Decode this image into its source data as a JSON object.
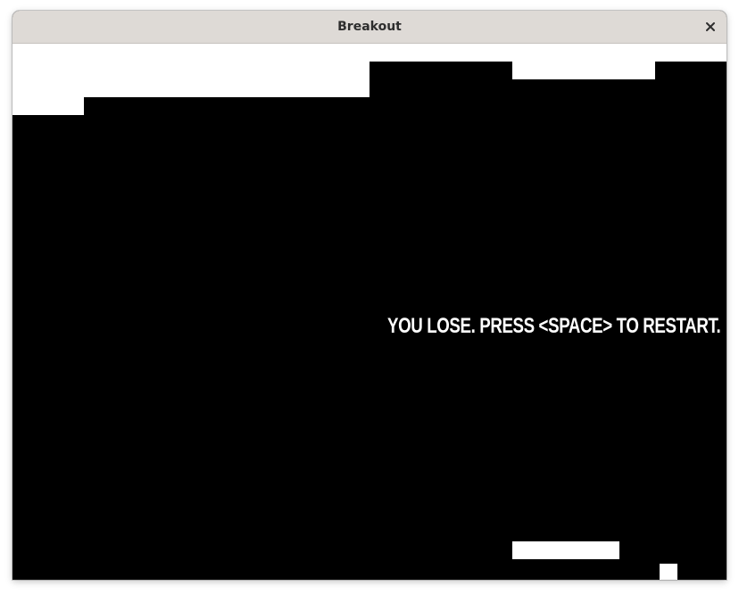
{
  "window": {
    "title": "Breakout",
    "close_icon": "close-icon"
  },
  "game": {
    "message": "YOU LOSE. PRESS <SPACE> TO RESTART.",
    "colors": {
      "background": "#000000",
      "bricks": "#ffffff",
      "paddle": "#ffffff",
      "ball": "#ffffff",
      "text": "#ffffff"
    }
  }
}
